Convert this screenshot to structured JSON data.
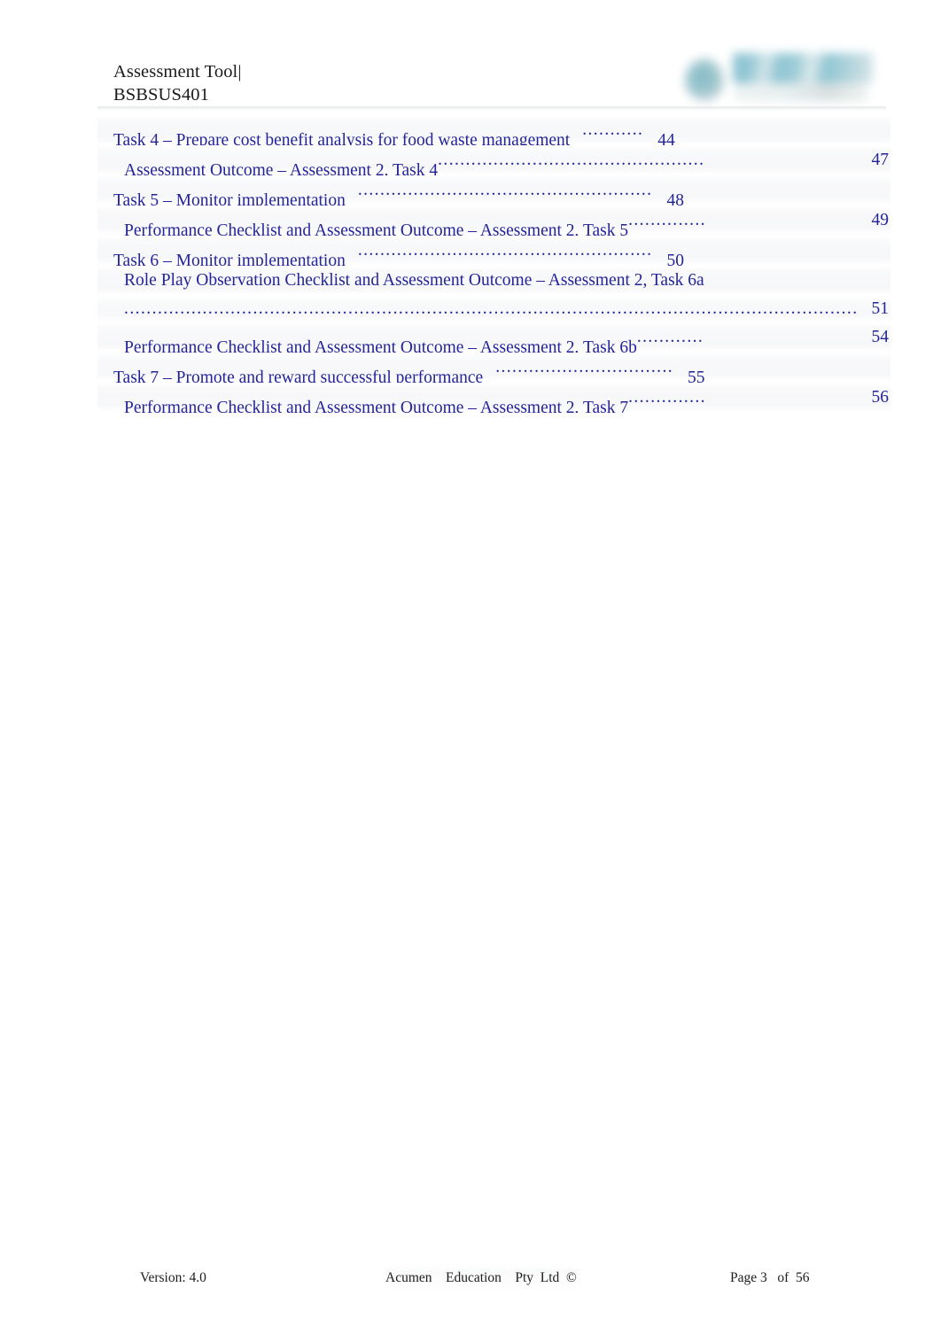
{
  "document": {
    "header": {
      "title": "Assessment Tool|",
      "subtitle": "BSBSUS401",
      "logo_alt": "Acumen Education logo",
      "logo_color": "#7fb8c4"
    },
    "toc": {
      "text_color": "#242499",
      "entries": [
        {
          "level": 1,
          "text": "Task  4  – Prepare    cost   benefit   analysis    for  food   waste    management",
          "leader": "...........",
          "page": "44",
          "page_at_right_margin": false
        },
        {
          "level": 2,
          "text": "Assessment     Outcome    – Assessment     2,  Task   4",
          "leader": "................................................",
          "page": "47",
          "page_at_right_margin": true
        },
        {
          "level": 1,
          "text": "Task   5  – Monitor   implementation",
          "leader": ".....................................................",
          "page": "48",
          "page_at_right_margin": false
        },
        {
          "level": 2,
          "text": "Performance     Checklist    and   Assessment     Outcome    – Assessment     2,  Task   5",
          "leader": "..............",
          "page": "49",
          "page_at_right_margin": true
        },
        {
          "level": 1,
          "text": "Task   6  – Monitor   implementation",
          "leader": ".....................................................",
          "page": "50",
          "page_at_right_margin": false
        },
        {
          "level": 2,
          "text": "Role   Play  Observation     Checklist    and   Assessment     Outcome    – Assessment     2,  Task   6a",
          "leader": "",
          "page": "51",
          "page_at_right_margin": true,
          "wrapped": true,
          "wrap_leader": "..................................................................................................................................."
        },
        {
          "level": 2,
          "text": "Performance     Checklist    and   Assessment     Outcome    – Assessment     2,  Task   6b",
          "leader": "............",
          "page": "54",
          "page_at_right_margin": true
        },
        {
          "level": 1,
          "text": "Task   7  – Promote    and   reward   successful    performance",
          "leader": "................................",
          "page": "55",
          "page_at_right_margin": false
        },
        {
          "level": 2,
          "text": "Performance     Checklist    and   Assessment     Outcome    – Assessment     2,  Task   7",
          "leader": "..............",
          "page": "56",
          "page_at_right_margin": true
        }
      ]
    },
    "footer": {
      "version": "Version: 4.0",
      "copyright": "Acumen    Education    Pty  Ltd  ©",
      "page_indicator": "Page 3   of  56"
    }
  }
}
